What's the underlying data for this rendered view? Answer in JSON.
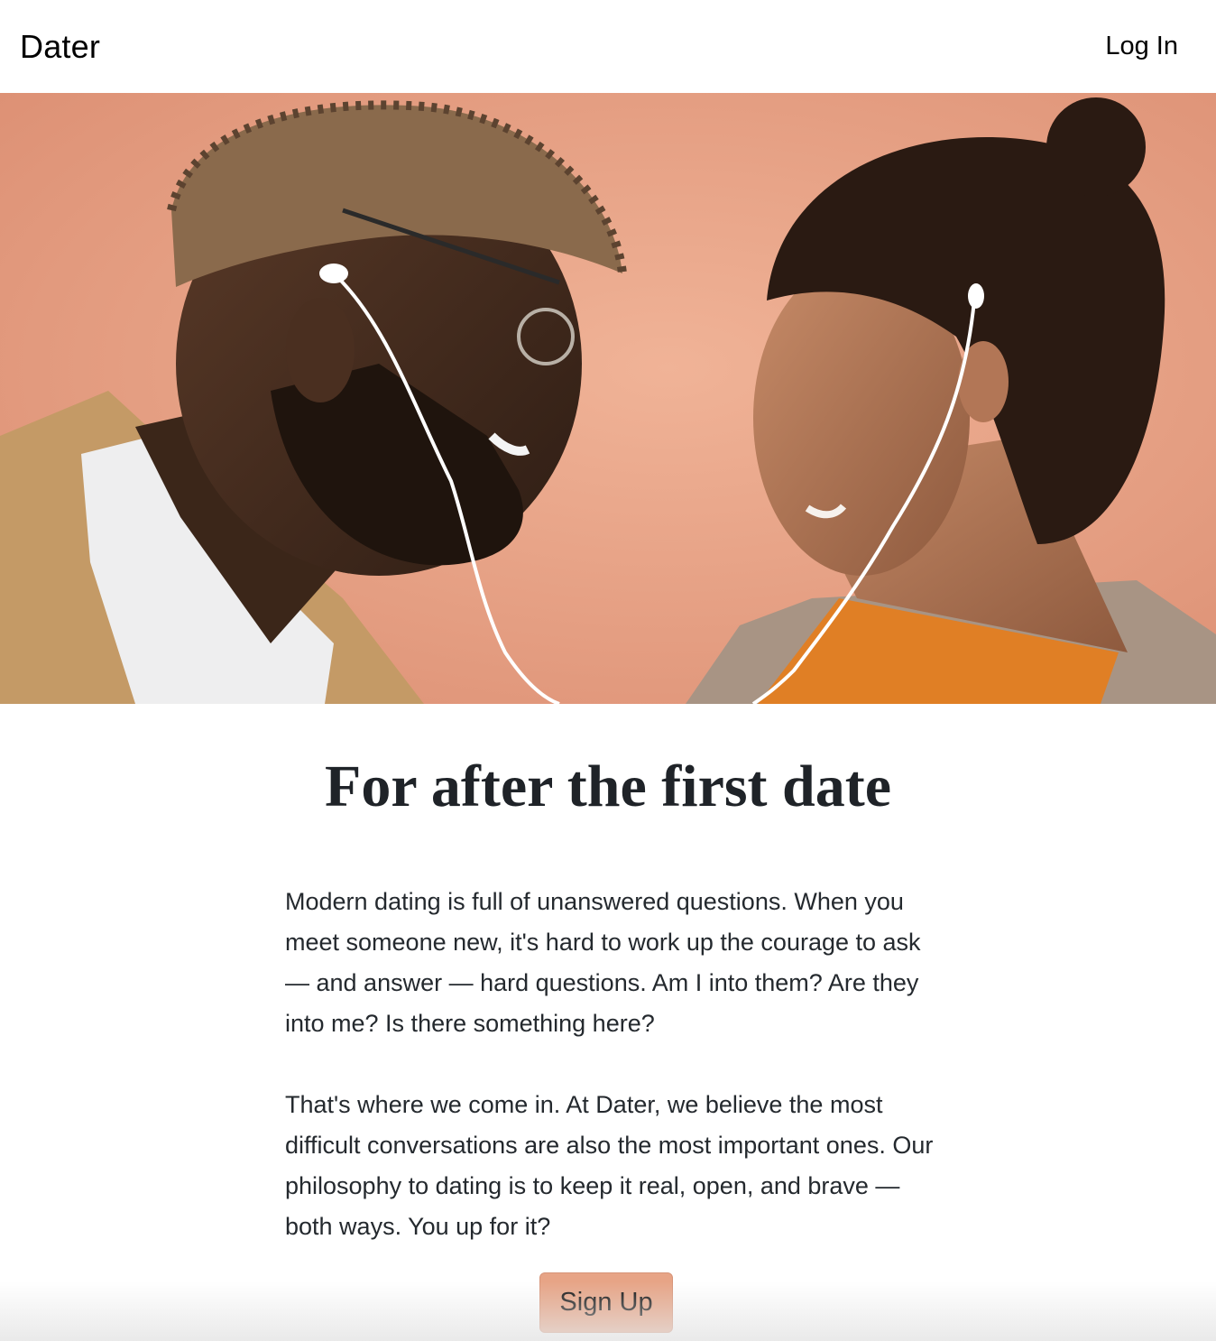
{
  "navbar": {
    "brand": "Dater",
    "login_label": "Log In"
  },
  "hero": {
    "image_description": "couple-sharing-earphones-photo",
    "background_color": "#e8a486"
  },
  "main": {
    "headline": "For after the first date",
    "paragraph_1": "Modern dating is full of unanswered questions. When you meet someone new, it's hard to work up the courage to ask — and answer — hard questions. Am I into them? Are they into me? Is there something here?",
    "paragraph_2": "That's where we come in. At Dater, we believe the most difficult conversations are also the most important ones. Our philosophy to dating is to keep it real, open, and brave — both ways. You up for it?",
    "signup_label": "Sign Up"
  },
  "colors": {
    "accent": "#e7a486",
    "text": "#212529"
  }
}
